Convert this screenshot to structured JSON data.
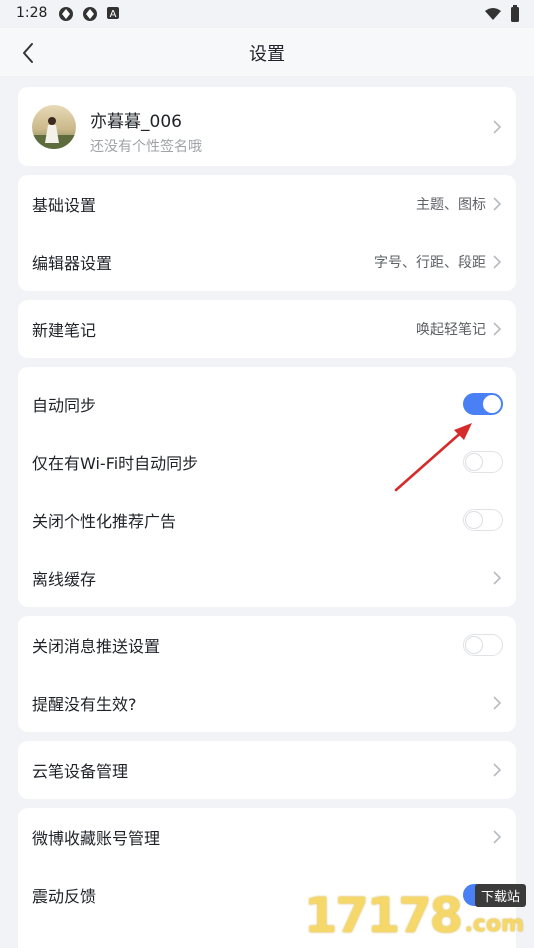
{
  "status_bar": {
    "time": "1:28",
    "icons": [
      "app-icon-1",
      "app-icon-2",
      "notification-a-icon",
      "wifi-icon",
      "battery-icon"
    ]
  },
  "header": {
    "title": "设置",
    "back_icon": "back-arrow-icon"
  },
  "profile": {
    "name": "亦暮暮_006",
    "signature": "还没有个性签名哦"
  },
  "groups": {
    "basic": {
      "items": [
        {
          "label": "基础设置",
          "value": "主题、图标"
        },
        {
          "label": "编辑器设置",
          "value": "字号、行距、段距"
        }
      ]
    },
    "note": {
      "items": [
        {
          "label": "新建笔记",
          "value": "唤起轻笔记"
        }
      ]
    },
    "sync": {
      "items": [
        {
          "label": "自动同步",
          "toggle": true
        },
        {
          "label": "仅在有Wi-Fi时自动同步",
          "toggle": false
        },
        {
          "label": "关闭个性化推荐广告",
          "toggle": false
        },
        {
          "label": "离线缓存"
        }
      ]
    },
    "push": {
      "items": [
        {
          "label": "关闭消息推送设置",
          "toggle": false
        },
        {
          "label": "提醒没有生效?"
        }
      ]
    },
    "pen": {
      "items": [
        {
          "label": "云笔设备管理"
        }
      ]
    },
    "misc": {
      "items": [
        {
          "label": "微博收藏账号管理"
        },
        {
          "label": "震动反馈",
          "toggle": true
        }
      ]
    }
  },
  "watermark": {
    "digits": "17178",
    "tag": "下载站",
    "suffix": ".com"
  },
  "colors": {
    "accent": "#4a80f5",
    "background": "#f2f3f7",
    "annotation_arrow": "#d62b2b"
  }
}
